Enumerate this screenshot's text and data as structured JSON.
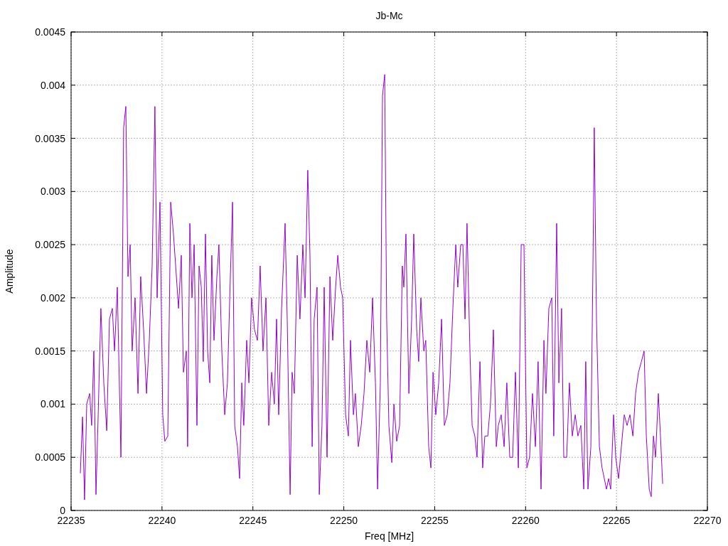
{
  "plot": {
    "chart_data": {
      "type": "line",
      "grid": true,
      "title": "Jb-Mc",
      "xlabel": "Freq [MHz]",
      "ylabel": "Amplitude",
      "xlim": [
        22235,
        22270
      ],
      "ylim": [
        0,
        0.0045
      ],
      "xticks": [
        22235,
        22240,
        22245,
        22250,
        22255,
        22260,
        22265,
        22270
      ],
      "yticks": [
        0,
        0.0005,
        0.001,
        0.0015,
        0.002,
        0.0025,
        0.003,
        0.0035,
        0.004,
        0.0045
      ],
      "x": [
        22235.51,
        22235.63,
        22235.74,
        22235.86,
        22236.02,
        22236.13,
        22236.25,
        22236.37,
        22236.49,
        22236.64,
        22236.8,
        22236.96,
        22237.11,
        22237.27,
        22237.39,
        22237.54,
        22237.74,
        22237.89,
        22238.01,
        22238.13,
        22238.25,
        22238.36,
        22238.52,
        22238.68,
        22238.83,
        22238.99,
        22239.15,
        22239.3,
        22239.46,
        22239.61,
        22239.73,
        22239.89,
        22240.04,
        22240.16,
        22240.32,
        22240.48,
        22240.63,
        22240.79,
        22240.91,
        22241.06,
        22241.18,
        22241.34,
        22241.41,
        22241.53,
        22241.65,
        22241.77,
        22241.92,
        22242.04,
        22242.16,
        22242.27,
        22242.39,
        22242.51,
        22242.63,
        22242.74,
        22242.86,
        22243.02,
        22243.13,
        22243.29,
        22243.45,
        22243.6,
        22243.76,
        22243.88,
        22244,
        22244.15,
        22244.27,
        22244.39,
        22244.5,
        22244.66,
        22244.78,
        22244.93,
        22245.09,
        22245.25,
        22245.4,
        22245.56,
        22245.72,
        22245.87,
        22246.03,
        22246.18,
        22246.3,
        22246.42,
        22246.58,
        22246.77,
        22246.89,
        22247.05,
        22247.16,
        22247.28,
        22247.44,
        22247.59,
        22247.75,
        22247.87,
        22248.02,
        22248.14,
        22248.26,
        22248.37,
        22248.53,
        22248.65,
        22248.8,
        22248.92,
        22249.08,
        22249.24,
        22249.39,
        22249.55,
        22249.67,
        22249.82,
        22249.94,
        22250.1,
        22250.25,
        22250.37,
        22250.53,
        22250.64,
        22250.8,
        22250.96,
        22251.11,
        22251.27,
        22251.43,
        22251.58,
        22251.74,
        22251.86,
        22252.01,
        22252.13,
        22252.25,
        22252.36,
        22252.48,
        22252.64,
        22252.76,
        22252.91,
        22253.07,
        22253.22,
        22253.3,
        22253.42,
        22253.58,
        22253.73,
        22253.85,
        22254.01,
        22254.12,
        22254.24,
        22254.4,
        22254.51,
        22254.67,
        22254.79,
        22254.91,
        22255.06,
        22255.22,
        22255.38,
        22255.53,
        22255.69,
        22255.84,
        22256,
        22256.16,
        22256.27,
        22256.43,
        22256.55,
        22256.67,
        22256.78,
        22256.94,
        22257.06,
        22257.21,
        22257.33,
        22257.49,
        22257.64,
        22257.76,
        22257.92,
        22258.07,
        22258.23,
        22258.39,
        22258.5,
        22258.66,
        22258.82,
        22258.97,
        22259.13,
        22259.29,
        22259.44,
        22259.6,
        22259.76,
        22259.91,
        22260.07,
        22260.22,
        22260.38,
        22260.54,
        22260.69,
        22260.85,
        22261.01,
        22261.12,
        22261.28,
        22261.44,
        22261.55,
        22261.71,
        22261.83,
        22261.98,
        22262.1,
        22262.26,
        22262.41,
        22262.57,
        22262.73,
        22262.88,
        22263.04,
        22263.2,
        22263.31,
        22263.43,
        22263.59,
        22263.71,
        22263.78,
        22263.9,
        22264.06,
        22264.21,
        22264.33,
        22264.45,
        22264.57,
        22264.68,
        22264.84,
        22264.96,
        22265.11,
        22265.27,
        22265.43,
        22265.58,
        22265.74,
        22265.9,
        22266.05,
        22266.21,
        22266.37,
        22266.52,
        22266.64,
        22266.8,
        22266.91,
        22267.03,
        22267.15,
        22267.3,
        22267.42,
        22267.54
      ],
      "series": [
        {
          "color": "#9400d3",
          "values": [
            0.00035,
            0.00088,
            0.0001,
            0.001,
            0.0011,
            0.0008,
            0.0015,
            0.00015,
            0.0009,
            0.0019,
            0.0012,
            0.00075,
            0.0018,
            0.0019,
            0.0015,
            0.0021,
            0.0005,
            0.0036,
            0.0038,
            0.0022,
            0.0025,
            0.0015,
            0.002,
            0.0011,
            0.0022,
            0.0017,
            0.0011,
            0.0016,
            0.0023,
            0.0038,
            0.002,
            0.0029,
            0.0009,
            0.00065,
            0.0007,
            0.0029,
            0.0026,
            0.0022,
            0.0019,
            0.0024,
            0.0013,
            0.0015,
            0.0006,
            0.0027,
            0.002,
            0.0025,
            0.0008,
            0.0023,
            0.0021,
            0.0014,
            0.0026,
            0.0015,
            0.0012,
            0.0024,
            0.0016,
            0.0022,
            0.0025,
            0.0015,
            0.0009,
            0.0012,
            0.0022,
            0.0029,
            0.0008,
            0.0006,
            0.0003,
            0.0012,
            0.0008,
            0.0016,
            0.0012,
            0.002,
            0.0017,
            0.0016,
            0.0023,
            0.0015,
            0.002,
            0.0008,
            0.0013,
            0.001,
            0.0018,
            0.0009,
            0.0019,
            0.0027,
            0.0018,
            0.00015,
            0.0013,
            0.0011,
            0.0024,
            0.0018,
            0.0025,
            0.002,
            0.0032,
            0.0024,
            0.0006,
            0.0018,
            0.0021,
            0.00015,
            0.0008,
            0.0021,
            0.0005,
            0.0022,
            0.0016,
            0.0021,
            0.0024,
            0.0021,
            0.002,
            0.0009,
            0.0007,
            0.0016,
            0.0009,
            0.0011,
            0.0006,
            0.0008,
            0.0011,
            0.0016,
            0.0013,
            0.002,
            0.0012,
            0.0002,
            0.0012,
            0.0039,
            0.0041,
            0.0018,
            0.0008,
            0.00045,
            0.001,
            0.00065,
            0.0008,
            0.0023,
            0.0021,
            0.0026,
            0.0011,
            0.0018,
            0.0026,
            0.0017,
            0.0014,
            0.002,
            0.0015,
            0.0016,
            0.0006,
            0.0004,
            0.0013,
            0.0009,
            0.0012,
            0.0018,
            0.0008,
            0.0009,
            0.0012,
            0.0019,
            0.0025,
            0.0021,
            0.0025,
            0.0025,
            0.0018,
            0.0027,
            0.0015,
            0.0008,
            0.0007,
            0.0005,
            0.0014,
            0.0004,
            0.0007,
            0.0007,
            0.001,
            0.0017,
            0.0006,
            0.0008,
            0.0009,
            0.0006,
            0.0012,
            0.0005,
            0.0005,
            0.0013,
            0.0004,
            0.0025,
            0.0025,
            0.0004,
            0.0005,
            0.0011,
            0.0006,
            0.0014,
            0.0002,
            0.0016,
            0.0011,
            0.0019,
            0.002,
            0.0007,
            0.0027,
            0.0012,
            0.0019,
            0.0005,
            0.0005,
            0.0012,
            0.0007,
            0.0009,
            0.0007,
            0.0008,
            0.0002,
            0.0014,
            0.0002,
            0.0006,
            0.0024,
            0.0036,
            0.0018,
            0.0006,
            0.0004,
            0.0003,
            0.0002,
            0.0003,
            0.0002,
            0.0009,
            0.0005,
            0.0003,
            0.0006,
            0.0009,
            0.0008,
            0.0009,
            0.0007,
            0.0011,
            0.0013,
            0.0014,
            0.0015,
            0.0007,
            0.0002,
            0.00013,
            0.0007,
            0.0005,
            0.0011,
            0.0007,
            0.00025
          ]
        }
      ]
    }
  }
}
